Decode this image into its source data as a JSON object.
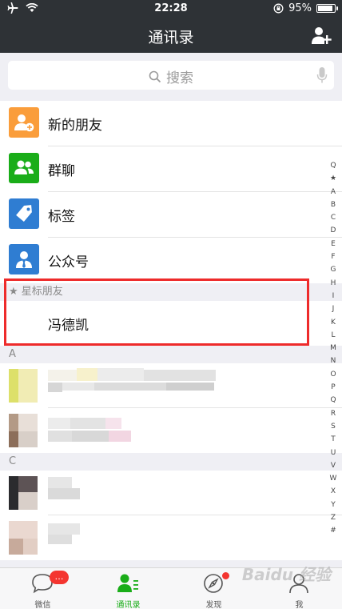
{
  "status": {
    "time": "22:28",
    "battery": "95%",
    "battery_level": 0.95
  },
  "nav": {
    "title": "通讯录"
  },
  "search": {
    "placeholder": "搜索"
  },
  "features": [
    {
      "label": "新的朋友",
      "color": "#fa9d3b",
      "icon": "add-friend-icon"
    },
    {
      "label": "群聊",
      "color": "#1aad19",
      "icon": "group-icon"
    },
    {
      "label": "标签",
      "color": "#2f7dd2",
      "icon": "tag-icon"
    },
    {
      "label": "公众号",
      "color": "#2f7dd2",
      "icon": "official-account-icon"
    }
  ],
  "starred": {
    "header": "★ 星标朋友",
    "contact": "冯德凯"
  },
  "sections": [
    {
      "letter": "A"
    },
    {
      "letter": "C"
    }
  ],
  "index": [
    "Q",
    "★",
    "A",
    "B",
    "C",
    "D",
    "E",
    "F",
    "G",
    "H",
    "I",
    "J",
    "K",
    "L",
    "M",
    "N",
    "O",
    "P",
    "Q",
    "R",
    "S",
    "T",
    "U",
    "V",
    "W",
    "X",
    "Y",
    "Z",
    "#"
  ],
  "tabs": [
    {
      "label": "微信",
      "badge": "…"
    },
    {
      "label": "通讯录"
    },
    {
      "label": "发现"
    },
    {
      "label": "我"
    }
  ],
  "watermark": "Baidu 经验",
  "colors": {
    "accent": "#1aad19",
    "nav": "#2e3236",
    "badge": "#f43530",
    "highlight": "#ee2b2b"
  }
}
